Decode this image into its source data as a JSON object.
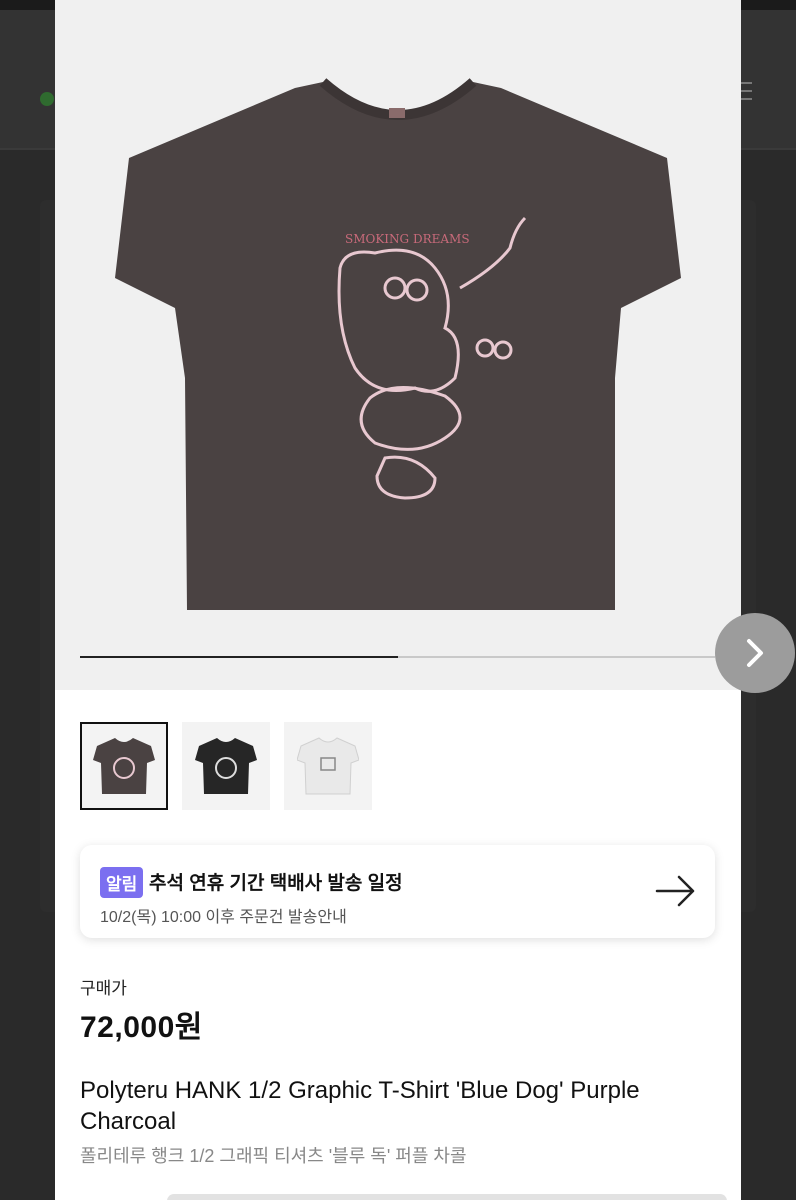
{
  "product": {
    "print_text": "SMOKING DREAMS",
    "image_progress": 0.5
  },
  "thumbnails": [
    {
      "color": "#4a4242"
    },
    {
      "color": "#262626"
    },
    {
      "color": "#e9e9e9"
    }
  ],
  "notice": {
    "badge": "알림",
    "title": "추석 연휴 기간 택배사 발송 일정",
    "subtitle": "10/2(목) 10:00 이후 주문건 발송안내",
    "arrow_icon": "arrow-right-icon"
  },
  "price": {
    "label": "구매가",
    "value": "72,000원"
  },
  "title": {
    "english": "Polyteru HANK 1/2 Graphic T-Shirt 'Blue Dog' Purple Charcoal",
    "korean": "폴리테루 행크 1/2 그래픽 티셔츠 '블루 독' 퍼플 차콜"
  },
  "colors": {
    "shirt": "#4a4242",
    "print": "#e8c8d0",
    "print_text": "#c86a7a",
    "badge": "#7b6ff0"
  },
  "icons": {
    "next": "chevron-right-icon"
  }
}
